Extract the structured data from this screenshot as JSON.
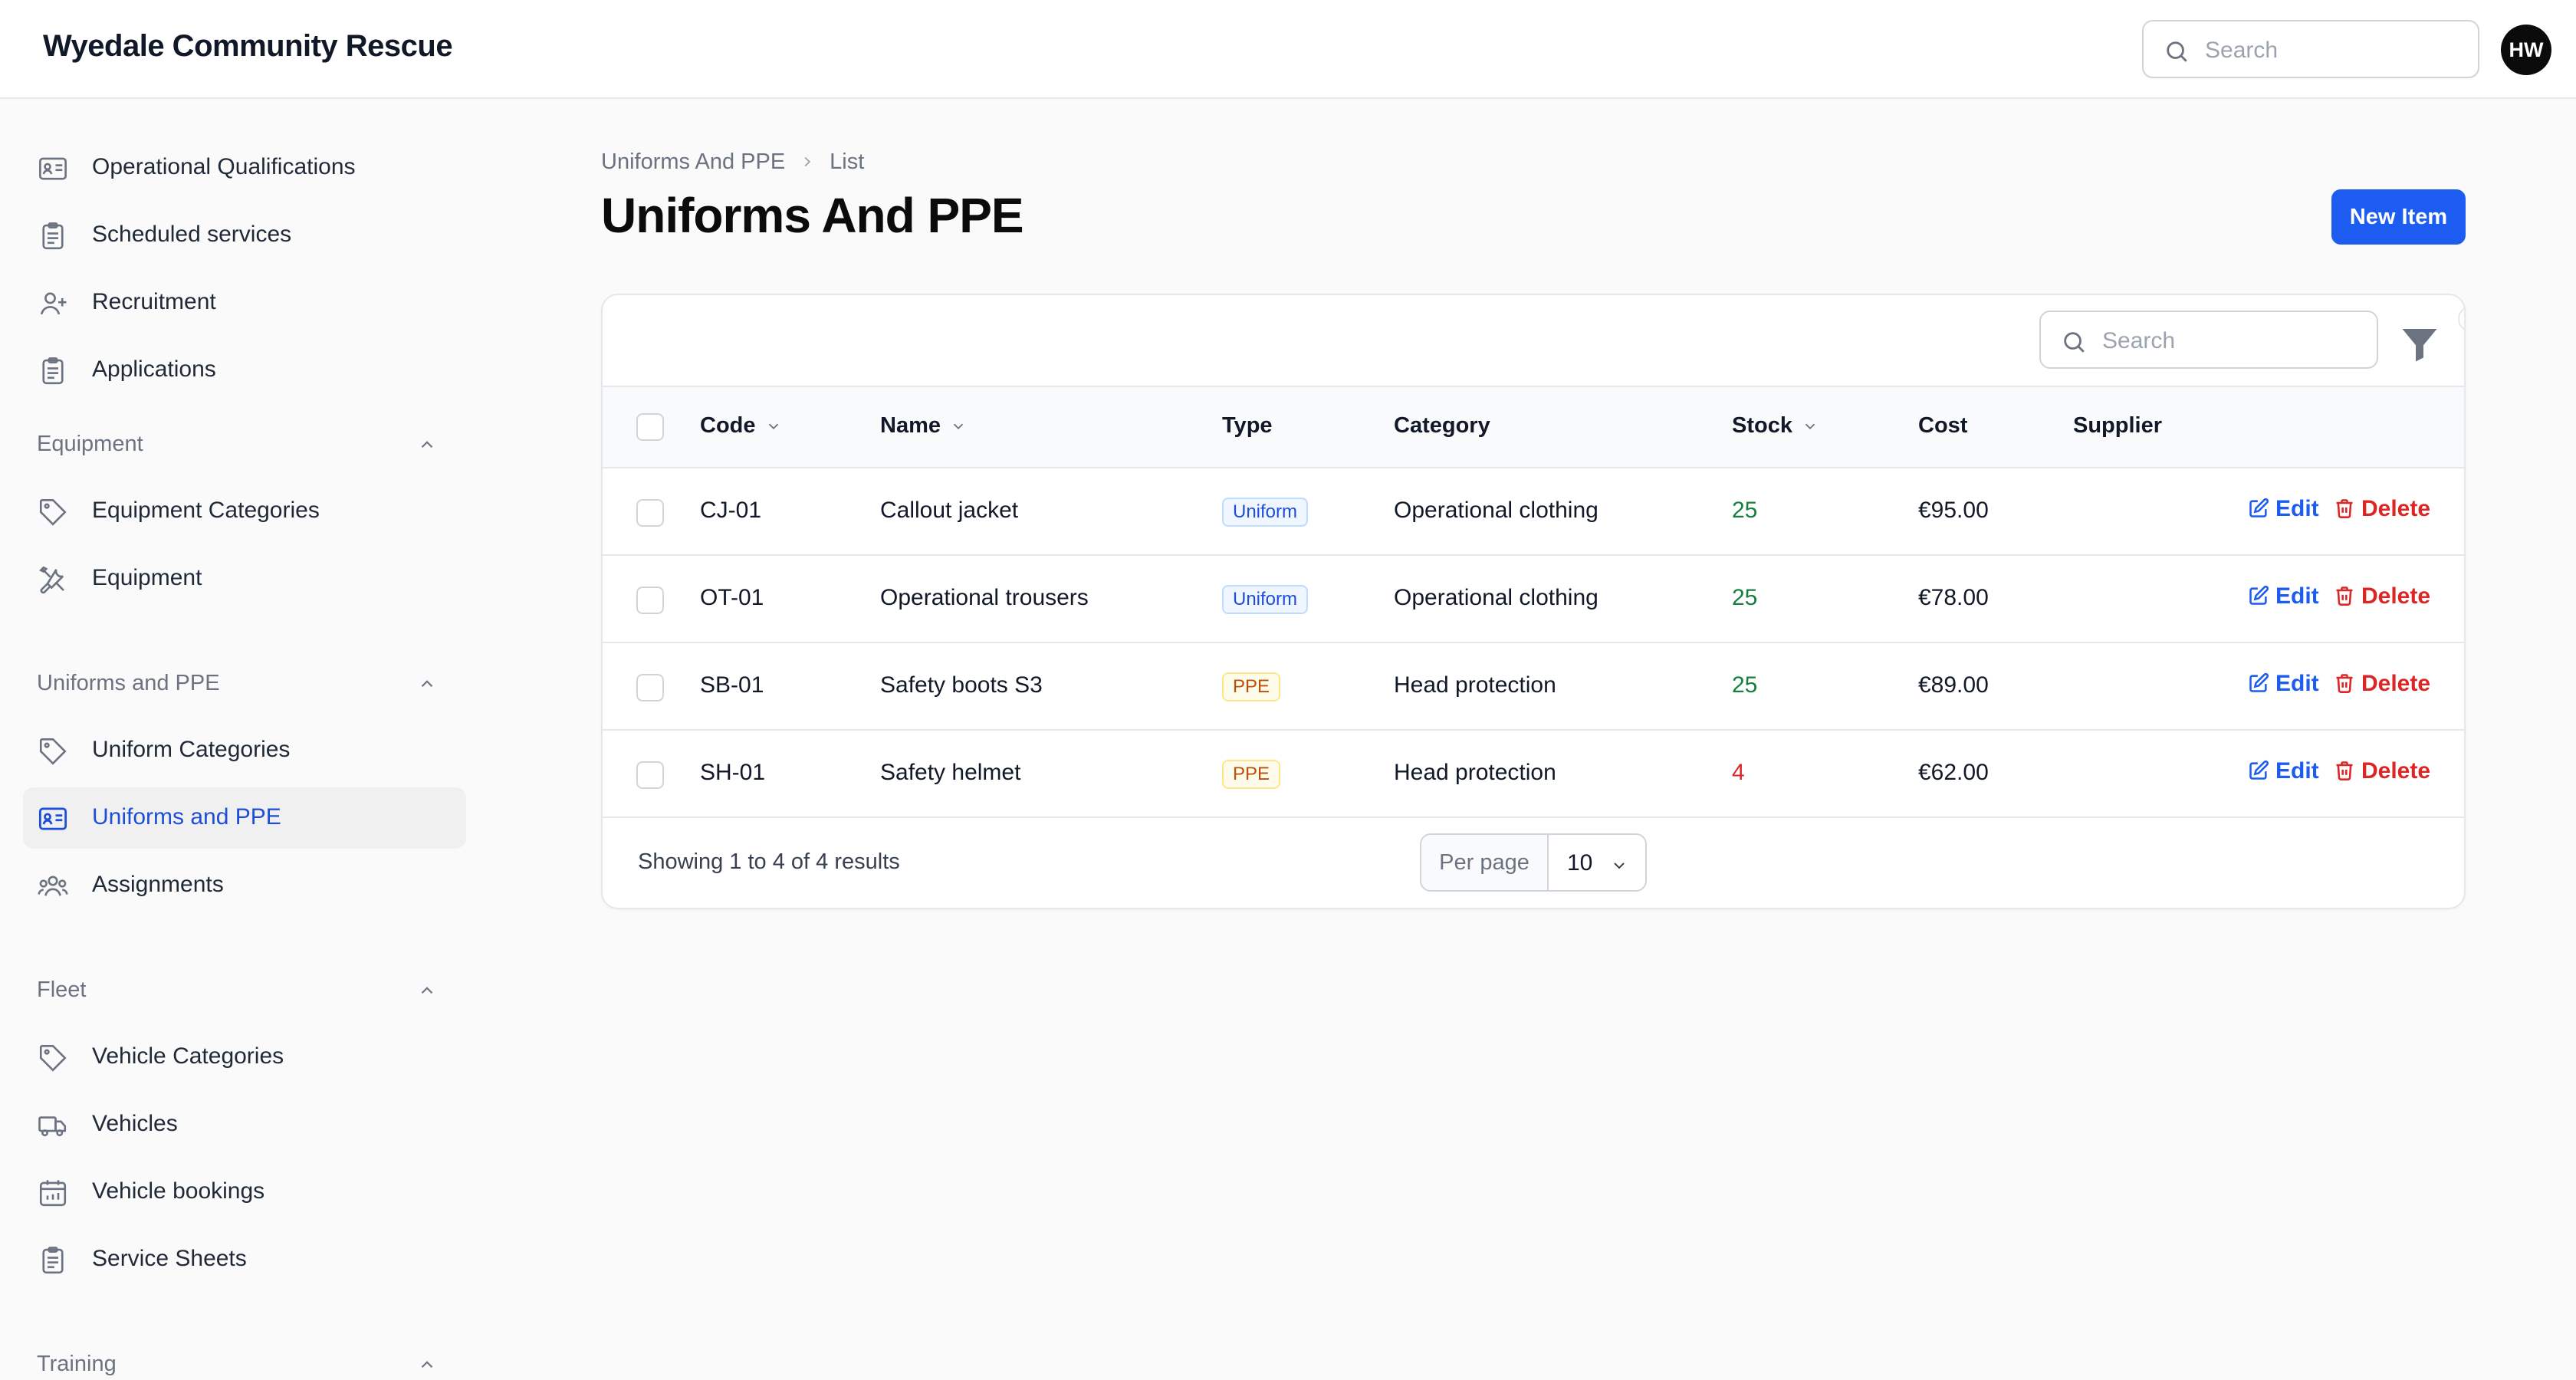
{
  "app": {
    "title": "Wyedale Community Rescue"
  },
  "topbar": {
    "search_placeholder": "Search",
    "avatar_initials": "HW"
  },
  "sidebar": {
    "items_top": [
      {
        "label": "Operational Qualifications",
        "icon": "id-card-icon"
      },
      {
        "label": "Scheduled services",
        "icon": "clipboard-icon"
      },
      {
        "label": "Recruitment",
        "icon": "user-plus-icon"
      },
      {
        "label": "Applications",
        "icon": "clipboard-icon"
      }
    ],
    "groups": [
      {
        "label": "Equipment",
        "items": [
          {
            "label": "Equipment Categories",
            "icon": "tag-icon"
          },
          {
            "label": "Equipment",
            "icon": "wrench-screwdriver-icon"
          }
        ]
      },
      {
        "label": "Uniforms and PPE",
        "items": [
          {
            "label": "Uniform Categories",
            "icon": "tag-icon"
          },
          {
            "label": "Uniforms and PPE",
            "icon": "id-card-icon",
            "active": true
          },
          {
            "label": "Assignments",
            "icon": "user-group-icon"
          }
        ]
      },
      {
        "label": "Fleet",
        "items": [
          {
            "label": "Vehicle Categories",
            "icon": "tag-icon"
          },
          {
            "label": "Vehicles",
            "icon": "truck-icon"
          },
          {
            "label": "Vehicle bookings",
            "icon": "calendar-icon"
          },
          {
            "label": "Service Sheets",
            "icon": "clipboard-icon"
          }
        ]
      },
      {
        "label": "Training",
        "items": []
      }
    ]
  },
  "breadcrumb": {
    "items": [
      "Uniforms And PPE",
      "List"
    ]
  },
  "page": {
    "title": "Uniforms And PPE",
    "new_button": "New Item"
  },
  "table": {
    "search_placeholder": "Search",
    "filter_count": "0",
    "columns": [
      "Code",
      "Name",
      "Type",
      "Category",
      "Stock",
      "Cost",
      "Supplier"
    ],
    "rows": [
      {
        "code": "CJ-01",
        "name": "Callout jacket",
        "type": "Uniform",
        "category": "Operational clothing",
        "stock": "25",
        "cost": "€95.00",
        "supplier": ""
      },
      {
        "code": "OT-01",
        "name": "Operational trousers",
        "type": "Uniform",
        "category": "Operational clothing",
        "stock": "25",
        "cost": "€78.00",
        "supplier": ""
      },
      {
        "code": "SB-01",
        "name": "Safety boots S3",
        "type": "PPE",
        "category": "Head protection",
        "stock": "25",
        "cost": "€89.00",
        "supplier": ""
      },
      {
        "code": "SH-01",
        "name": "Safety helmet",
        "type": "PPE",
        "category": "Head protection",
        "stock": "4",
        "cost": "€62.00",
        "supplier": ""
      }
    ],
    "edit_label": "Edit",
    "delete_label": "Delete",
    "footer": {
      "showing": "Showing 1 to 4 of 4 results",
      "per_page_label": "Per page",
      "per_page_value": "10"
    }
  },
  "colors": {
    "accent": "#1d5cf0",
    "danger": "#dc2626",
    "success": "#15803d"
  }
}
